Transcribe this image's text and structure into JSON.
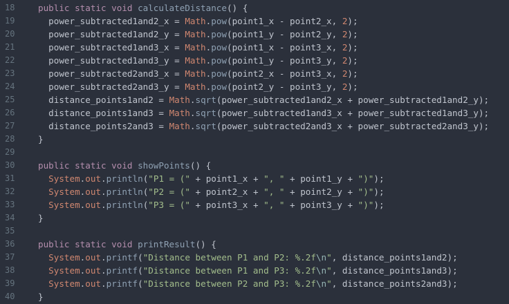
{
  "editor": {
    "background": "#2b303b",
    "line_number_color": "#65737e",
    "colors": {
      "kw": "#b48ead",
      "fn": "#8fa1b3",
      "cls": "#d08770",
      "num": "#d08770",
      "str": "#a3be8c",
      "esc": "#96b5b4",
      "plain": "#c0c5ce"
    },
    "lines": [
      {
        "n": "18",
        "indent": "",
        "tokens": [
          {
            "t": "kw",
            "v": "public static void "
          },
          {
            "t": "fn",
            "v": "calculateDistance"
          },
          {
            "t": "plain",
            "v": "() {"
          }
        ]
      },
      {
        "n": "19",
        "indent": "  ",
        "tokens": [
          {
            "t": "plain",
            "v": "power_subtracted1and2_x = "
          },
          {
            "t": "cls",
            "v": "Math"
          },
          {
            "t": "plain",
            "v": "."
          },
          {
            "t": "fn",
            "v": "pow"
          },
          {
            "t": "plain",
            "v": "(point1_x - point2_x, "
          },
          {
            "t": "num",
            "v": "2"
          },
          {
            "t": "plain",
            "v": ");"
          }
        ]
      },
      {
        "n": "20",
        "indent": "  ",
        "tokens": [
          {
            "t": "plain",
            "v": "power_subtracted1and2_y = "
          },
          {
            "t": "cls",
            "v": "Math"
          },
          {
            "t": "plain",
            "v": "."
          },
          {
            "t": "fn",
            "v": "pow"
          },
          {
            "t": "plain",
            "v": "(point1_y - point2_y, "
          },
          {
            "t": "num",
            "v": "2"
          },
          {
            "t": "plain",
            "v": ");"
          }
        ]
      },
      {
        "n": "21",
        "indent": "  ",
        "tokens": [
          {
            "t": "plain",
            "v": "power_subtracted1and3_x = "
          },
          {
            "t": "cls",
            "v": "Math"
          },
          {
            "t": "plain",
            "v": "."
          },
          {
            "t": "fn",
            "v": "pow"
          },
          {
            "t": "plain",
            "v": "(point1_x - point3_x, "
          },
          {
            "t": "num",
            "v": "2"
          },
          {
            "t": "plain",
            "v": ");"
          }
        ]
      },
      {
        "n": "22",
        "indent": "  ",
        "tokens": [
          {
            "t": "plain",
            "v": "power_subtracted1and3_y = "
          },
          {
            "t": "cls",
            "v": "Math"
          },
          {
            "t": "plain",
            "v": "."
          },
          {
            "t": "fn",
            "v": "pow"
          },
          {
            "t": "plain",
            "v": "(point1_y - point3_y, "
          },
          {
            "t": "num",
            "v": "2"
          },
          {
            "t": "plain",
            "v": ");"
          }
        ]
      },
      {
        "n": "23",
        "indent": "  ",
        "tokens": [
          {
            "t": "plain",
            "v": "power_subtracted2and3_x = "
          },
          {
            "t": "cls",
            "v": "Math"
          },
          {
            "t": "plain",
            "v": "."
          },
          {
            "t": "fn",
            "v": "pow"
          },
          {
            "t": "plain",
            "v": "(point2_x - point3_x, "
          },
          {
            "t": "num",
            "v": "2"
          },
          {
            "t": "plain",
            "v": ");"
          }
        ]
      },
      {
        "n": "24",
        "indent": "  ",
        "tokens": [
          {
            "t": "plain",
            "v": "power_subtracted2and3_y = "
          },
          {
            "t": "cls",
            "v": "Math"
          },
          {
            "t": "plain",
            "v": "."
          },
          {
            "t": "fn",
            "v": "pow"
          },
          {
            "t": "plain",
            "v": "(point2_y - point3_y, "
          },
          {
            "t": "num",
            "v": "2"
          },
          {
            "t": "plain",
            "v": ");"
          }
        ]
      },
      {
        "n": "25",
        "indent": "  ",
        "tokens": [
          {
            "t": "plain",
            "v": "distance_points1and2 = "
          },
          {
            "t": "cls",
            "v": "Math"
          },
          {
            "t": "plain",
            "v": "."
          },
          {
            "t": "fn",
            "v": "sqrt"
          },
          {
            "t": "plain",
            "v": "(power_subtracted1and2_x + power_subtracted1and2_y);"
          }
        ]
      },
      {
        "n": "26",
        "indent": "  ",
        "tokens": [
          {
            "t": "plain",
            "v": "distance_points1and3 = "
          },
          {
            "t": "cls",
            "v": "Math"
          },
          {
            "t": "plain",
            "v": "."
          },
          {
            "t": "fn",
            "v": "sqrt"
          },
          {
            "t": "plain",
            "v": "(power_subtracted1and3_x + power_subtracted1and3_y);"
          }
        ]
      },
      {
        "n": "27",
        "indent": "  ",
        "tokens": [
          {
            "t": "plain",
            "v": "distance_points2and3 = "
          },
          {
            "t": "cls",
            "v": "Math"
          },
          {
            "t": "plain",
            "v": "."
          },
          {
            "t": "fn",
            "v": "sqrt"
          },
          {
            "t": "plain",
            "v": "(power_subtracted2and3_x + power_subtracted2and3_y);"
          }
        ]
      },
      {
        "n": "28",
        "indent": "",
        "tokens": [
          {
            "t": "plain",
            "v": "}"
          }
        ]
      },
      {
        "n": "29",
        "indent": "",
        "tokens": []
      },
      {
        "n": "30",
        "indent": "",
        "tokens": [
          {
            "t": "kw",
            "v": "public static void "
          },
          {
            "t": "fn",
            "v": "showPoints"
          },
          {
            "t": "plain",
            "v": "() {"
          }
        ]
      },
      {
        "n": "31",
        "indent": "  ",
        "tokens": [
          {
            "t": "cls",
            "v": "System"
          },
          {
            "t": "plain",
            "v": "."
          },
          {
            "t": "cls",
            "v": "out"
          },
          {
            "t": "plain",
            "v": "."
          },
          {
            "t": "fn",
            "v": "println"
          },
          {
            "t": "plain",
            "v": "("
          },
          {
            "t": "str",
            "v": "\"P1 = (\""
          },
          {
            "t": "plain",
            "v": " + point1_x + "
          },
          {
            "t": "str",
            "v": "\", \""
          },
          {
            "t": "plain",
            "v": " + point1_y + "
          },
          {
            "t": "str",
            "v": "\")\""
          },
          {
            "t": "plain",
            "v": ");"
          }
        ]
      },
      {
        "n": "32",
        "indent": "  ",
        "tokens": [
          {
            "t": "cls",
            "v": "System"
          },
          {
            "t": "plain",
            "v": "."
          },
          {
            "t": "cls",
            "v": "out"
          },
          {
            "t": "plain",
            "v": "."
          },
          {
            "t": "fn",
            "v": "println"
          },
          {
            "t": "plain",
            "v": "("
          },
          {
            "t": "str",
            "v": "\"P2 = (\""
          },
          {
            "t": "plain",
            "v": " + point2_x + "
          },
          {
            "t": "str",
            "v": "\", \""
          },
          {
            "t": "plain",
            "v": " + point2_y + "
          },
          {
            "t": "str",
            "v": "\")\""
          },
          {
            "t": "plain",
            "v": ");"
          }
        ]
      },
      {
        "n": "33",
        "indent": "  ",
        "tokens": [
          {
            "t": "cls",
            "v": "System"
          },
          {
            "t": "plain",
            "v": "."
          },
          {
            "t": "cls",
            "v": "out"
          },
          {
            "t": "plain",
            "v": "."
          },
          {
            "t": "fn",
            "v": "println"
          },
          {
            "t": "plain",
            "v": "("
          },
          {
            "t": "str",
            "v": "\"P3 = (\""
          },
          {
            "t": "plain",
            "v": " + point3_x + "
          },
          {
            "t": "str",
            "v": "\", \""
          },
          {
            "t": "plain",
            "v": " + point3_y + "
          },
          {
            "t": "str",
            "v": "\")\""
          },
          {
            "t": "plain",
            "v": ");"
          }
        ]
      },
      {
        "n": "34",
        "indent": "",
        "tokens": [
          {
            "t": "plain",
            "v": "}"
          }
        ]
      },
      {
        "n": "35",
        "indent": "",
        "tokens": []
      },
      {
        "n": "36",
        "indent": "",
        "tokens": [
          {
            "t": "kw",
            "v": "public static void "
          },
          {
            "t": "fn",
            "v": "printResult"
          },
          {
            "t": "plain",
            "v": "() {"
          }
        ]
      },
      {
        "n": "37",
        "indent": "  ",
        "tokens": [
          {
            "t": "cls",
            "v": "System"
          },
          {
            "t": "plain",
            "v": "."
          },
          {
            "t": "cls",
            "v": "out"
          },
          {
            "t": "plain",
            "v": "."
          },
          {
            "t": "fn",
            "v": "printf"
          },
          {
            "t": "plain",
            "v": "("
          },
          {
            "t": "str",
            "v": "\"Distance between P1 and P2: %.2f"
          },
          {
            "t": "esc",
            "v": "\\n"
          },
          {
            "t": "str",
            "v": "\""
          },
          {
            "t": "plain",
            "v": ", distance_points1and2);"
          }
        ]
      },
      {
        "n": "38",
        "indent": "  ",
        "tokens": [
          {
            "t": "cls",
            "v": "System"
          },
          {
            "t": "plain",
            "v": "."
          },
          {
            "t": "cls",
            "v": "out"
          },
          {
            "t": "plain",
            "v": "."
          },
          {
            "t": "fn",
            "v": "printf"
          },
          {
            "t": "plain",
            "v": "("
          },
          {
            "t": "str",
            "v": "\"Distance between P1 and P3: %.2f"
          },
          {
            "t": "esc",
            "v": "\\n"
          },
          {
            "t": "str",
            "v": "\""
          },
          {
            "t": "plain",
            "v": ", distance_points1and3);"
          }
        ]
      },
      {
        "n": "39",
        "indent": "  ",
        "tokens": [
          {
            "t": "cls",
            "v": "System"
          },
          {
            "t": "plain",
            "v": "."
          },
          {
            "t": "cls",
            "v": "out"
          },
          {
            "t": "plain",
            "v": "."
          },
          {
            "t": "fn",
            "v": "printf"
          },
          {
            "t": "plain",
            "v": "("
          },
          {
            "t": "str",
            "v": "\"Distance between P2 and P3: %.2f"
          },
          {
            "t": "esc",
            "v": "\\n"
          },
          {
            "t": "str",
            "v": "\""
          },
          {
            "t": "plain",
            "v": ", distance_points2and3);"
          }
        ]
      },
      {
        "n": "40",
        "indent": "",
        "tokens": [
          {
            "t": "plain",
            "v": "}"
          }
        ]
      }
    ]
  }
}
